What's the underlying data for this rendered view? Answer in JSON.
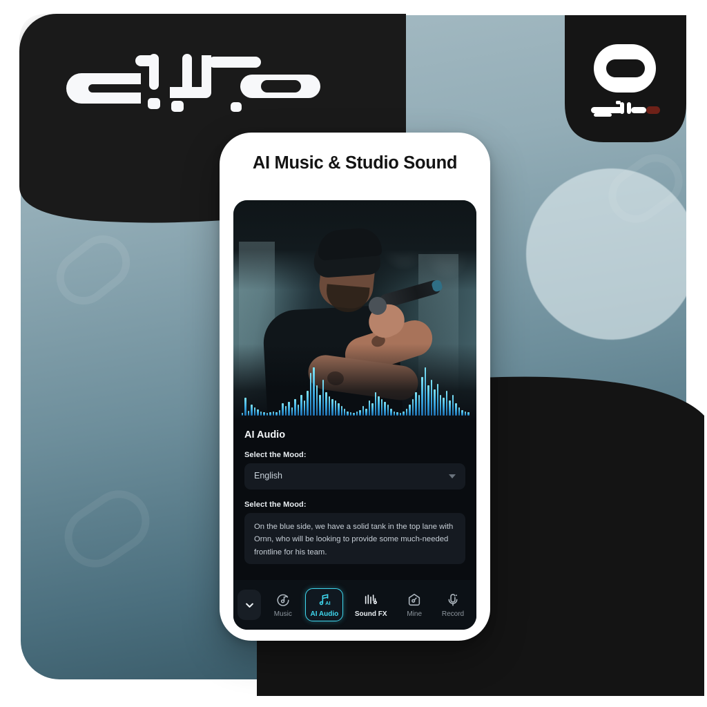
{
  "brand": {
    "wordmark_text": "مجازینت",
    "badge_text": "مجازینت",
    "accent_red": "#6e2118",
    "dark": "#151515"
  },
  "phone": {
    "title": "AI Music & Studio Sound",
    "panel": {
      "heading": "AI Audio",
      "mood_label": "Select the Mood:",
      "language_value": "English",
      "prompt_label": "Select the Mood:",
      "prompt_value": "On the blue side, we have a solid tank in the top lane with Ornn, who will be looking to provide some much-needed frontline for his team."
    },
    "nav": {
      "collapse_icon": "chevron-down-icon",
      "items": [
        {
          "label": "Music",
          "icon": "music-note-circle-icon",
          "active": false
        },
        {
          "label": "AI Audio",
          "icon": "ai-note-icon",
          "active": true
        },
        {
          "label": "Sound FX",
          "icon": "equalizer-bars-icon",
          "active": false
        },
        {
          "label": "Mine",
          "icon": "home-key-icon",
          "active": false
        },
        {
          "label": "Record",
          "icon": "microphone-sparkle-icon",
          "active": false
        }
      ]
    }
  },
  "colors": {
    "accent_cyan": "#3fd8ef",
    "screen_bg": "#090c10",
    "field_bg": "#151a21",
    "panel_blue_top": "#a8bdc5",
    "panel_blue_bottom": "#2f4f5c"
  },
  "waveform": {
    "bars": [
      4,
      26,
      7,
      16,
      12,
      9,
      6,
      5,
      4,
      5,
      6,
      5,
      8,
      18,
      14,
      20,
      12,
      24,
      16,
      30,
      22,
      36,
      62,
      70,
      44,
      30,
      52,
      34,
      28,
      24,
      22,
      18,
      14,
      10,
      6,
      5,
      4,
      6,
      8,
      14,
      10,
      22,
      18,
      34,
      28,
      24,
      20,
      16,
      10,
      6,
      5,
      4,
      6,
      10,
      16,
      24,
      34,
      30,
      56,
      70,
      44,
      52,
      38,
      46,
      30,
      26,
      36,
      22,
      30,
      18,
      12,
      8,
      6,
      5
    ]
  }
}
